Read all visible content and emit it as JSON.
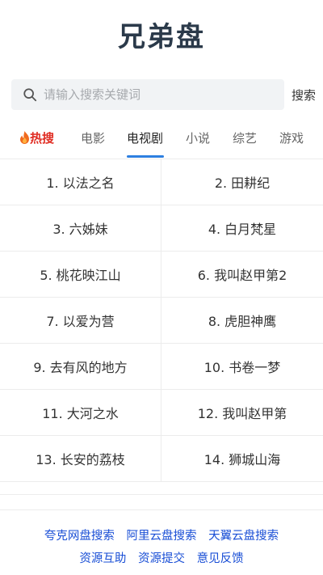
{
  "header": {
    "title": "兄弟盘"
  },
  "search": {
    "placeholder": "请输入搜索关键词",
    "button_label": "搜索"
  },
  "tabs": [
    {
      "label": "热搜",
      "icon": "fire-icon"
    },
    {
      "label": "电影"
    },
    {
      "label": "电视剧",
      "active": true
    },
    {
      "label": "小说"
    },
    {
      "label": "综艺"
    },
    {
      "label": "游戏"
    }
  ],
  "list": [
    "1. 以法之名",
    "2. 田耕纪",
    "3. 六姊妹",
    "4. 白月梵星",
    "5. 桃花映江山",
    "6. 我叫赵甲第2",
    "7. 以爱为营",
    "8. 虎胆神鹰",
    "9. 去有风的地方",
    "10. 书卷一梦",
    "11. 大河之水",
    "12. 我叫赵甲第",
    "13. 长安的荔枝",
    "14. 狮城山海"
  ],
  "footer": {
    "links": [
      "夸克网盘搜索",
      "阿里云盘搜索",
      "天翼云盘搜索",
      "资源互助",
      "资源提交",
      "意见反馈"
    ]
  },
  "colors": {
    "accent": "#2d7fe0",
    "hot": "#e02e24",
    "link": "#1a4fd6",
    "title": "#2b3a4a"
  }
}
